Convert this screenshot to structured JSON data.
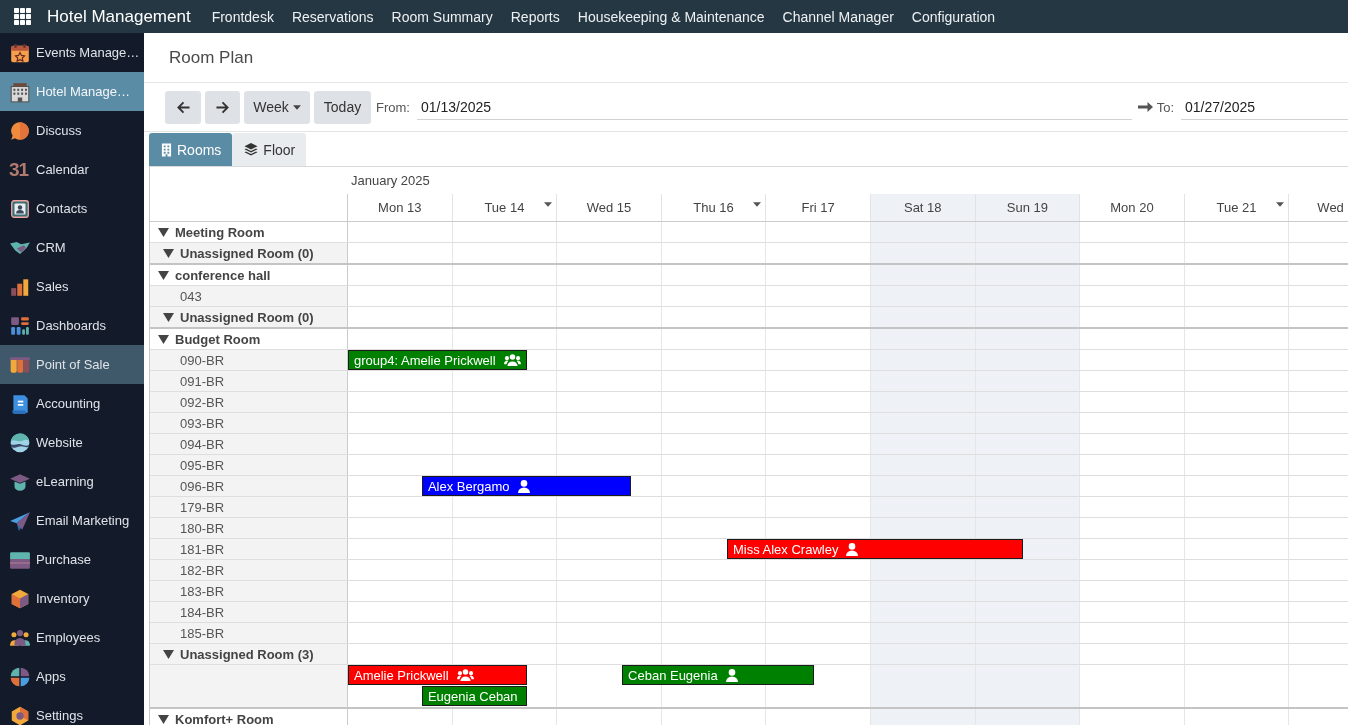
{
  "topbar": {
    "title": "Hotel Management",
    "menu": [
      "Frontdesk",
      "Reservations",
      "Room Summary",
      "Reports",
      "Housekeeping & Maintenance",
      "Channel Manager",
      "Configuration"
    ]
  },
  "sidebar": {
    "items": [
      {
        "label": "Events Manage…",
        "selected": false,
        "hovered": false
      },
      {
        "label": "Hotel Manage…",
        "selected": true,
        "hovered": false
      },
      {
        "label": "Discuss",
        "selected": false,
        "hovered": false
      },
      {
        "label": "Calendar",
        "icon_text": "31",
        "selected": false,
        "hovered": false
      },
      {
        "label": "Contacts",
        "selected": false,
        "hovered": false
      },
      {
        "label": "CRM",
        "selected": false,
        "hovered": false
      },
      {
        "label": "Sales",
        "selected": false,
        "hovered": false
      },
      {
        "label": "Dashboards",
        "selected": false,
        "hovered": false
      },
      {
        "label": "Point of Sale",
        "selected": false,
        "hovered": true
      },
      {
        "label": "Accounting",
        "selected": false,
        "hovered": false
      },
      {
        "label": "Website",
        "selected": false,
        "hovered": false
      },
      {
        "label": "eLearning",
        "selected": false,
        "hovered": false
      },
      {
        "label": "Email Marketing",
        "selected": false,
        "hovered": false
      },
      {
        "label": "Purchase",
        "selected": false,
        "hovered": false
      },
      {
        "label": "Inventory",
        "selected": false,
        "hovered": false
      },
      {
        "label": "Employees",
        "selected": false,
        "hovered": false
      },
      {
        "label": "Apps",
        "selected": false,
        "hovered": false
      },
      {
        "label": "Settings",
        "selected": false,
        "hovered": false
      }
    ]
  },
  "page": {
    "title": "Room Plan"
  },
  "toolbar": {
    "period": "Week",
    "today": "Today",
    "from": {
      "label": "From:",
      "value": "01/13/2025"
    },
    "to": {
      "label": "To:",
      "value": "01/27/2025"
    }
  },
  "tabs": [
    {
      "label": "Rooms",
      "selected": true
    },
    {
      "label": "Floor",
      "selected": false
    }
  ],
  "plan": {
    "month": "January 2025",
    "days": [
      {
        "label": "Mon 13",
        "weekend": false,
        "has_menu": false
      },
      {
        "label": "Tue 14",
        "weekend": false,
        "has_menu": true
      },
      {
        "label": "Wed 15",
        "weekend": false,
        "has_menu": false
      },
      {
        "label": "Thu 16",
        "weekend": false,
        "has_menu": true
      },
      {
        "label": "Fri 17",
        "weekend": false,
        "has_menu": false
      },
      {
        "label": "Sat 18",
        "weekend": true,
        "has_menu": false
      },
      {
        "label": "Sun 19",
        "weekend": true,
        "has_menu": false
      },
      {
        "label": "Mon 20",
        "weekend": false,
        "has_menu": false
      },
      {
        "label": "Tue 21",
        "weekend": false,
        "has_menu": true
      },
      {
        "label": "Wed",
        "weekend": false,
        "has_menu": false
      }
    ],
    "groups": [
      {
        "name": "Meeting Room",
        "expanded": true,
        "children": [
          {
            "kind": "unassigned",
            "label": "Unassigned Room (0)",
            "expanded": true
          }
        ]
      },
      {
        "name": "conference hall",
        "expanded": true,
        "children": [
          {
            "kind": "room",
            "label": "043"
          },
          {
            "kind": "unassigned",
            "label": "Unassigned Room (0)",
            "expanded": true
          }
        ]
      },
      {
        "name": "Budget Room",
        "expanded": true,
        "children": [
          {
            "kind": "room",
            "label": "090-BR",
            "bookings": [
              {
                "guest": "group4: Amelie Prickwell",
                "color": "#008000",
                "kind": "group"
              }
            ]
          },
          {
            "kind": "room",
            "label": "091-BR"
          },
          {
            "kind": "room",
            "label": "092-BR"
          },
          {
            "kind": "room",
            "label": "093-BR"
          },
          {
            "kind": "room",
            "label": "094-BR"
          },
          {
            "kind": "room",
            "label": "095-BR"
          },
          {
            "kind": "room",
            "label": "096-BR",
            "bookings": [
              {
                "guest": "Alex Bergamo",
                "color": "#0000ff",
                "kind": "individual"
              }
            ]
          },
          {
            "kind": "room",
            "label": "179-BR"
          },
          {
            "kind": "room",
            "label": "180-BR"
          },
          {
            "kind": "room",
            "label": "181-BR",
            "bookings": [
              {
                "guest": "Miss Alex Crawley",
                "color": "#ff0000",
                "kind": "individual"
              }
            ]
          },
          {
            "kind": "room",
            "label": "182-BR"
          },
          {
            "kind": "room",
            "label": "183-BR"
          },
          {
            "kind": "room",
            "label": "184-BR"
          },
          {
            "kind": "room",
            "label": "185-BR"
          },
          {
            "kind": "unassigned",
            "label": "Unassigned Room (3)",
            "expanded": true,
            "bookings": [
              {
                "guest": "Amelie Prickwell",
                "color": "#ff0000",
                "kind": "group"
              },
              {
                "guest": "Ceban Eugenia",
                "color": "#008000",
                "kind": "individual"
              },
              {
                "guest": "Eugenia Ceban",
                "color": "#008000",
                "kind": "plain"
              }
            ]
          }
        ]
      },
      {
        "name": "Komfort+ Room",
        "expanded": true
      }
    ]
  }
}
